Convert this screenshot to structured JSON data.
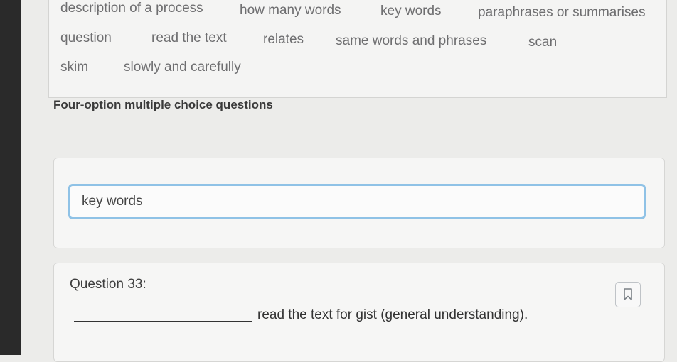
{
  "word_bank": {
    "words": [
      "description of a process",
      "how many words",
      "key words",
      "paraphrases or summarises",
      "question",
      "read the text",
      "relates",
      "same words and phrases",
      "scan",
      "skim",
      "slowly and carefully"
    ]
  },
  "section": {
    "title": "Four-option multiple choice questions"
  },
  "answer": {
    "value": "key words"
  },
  "question": {
    "label": "Question 33:",
    "text": "read the text for gist (general understanding)."
  },
  "icons": {
    "bookmark": "bookmark-icon"
  },
  "colors": {
    "input_focus_border": "#8fc2e6",
    "background": "#ececea"
  }
}
